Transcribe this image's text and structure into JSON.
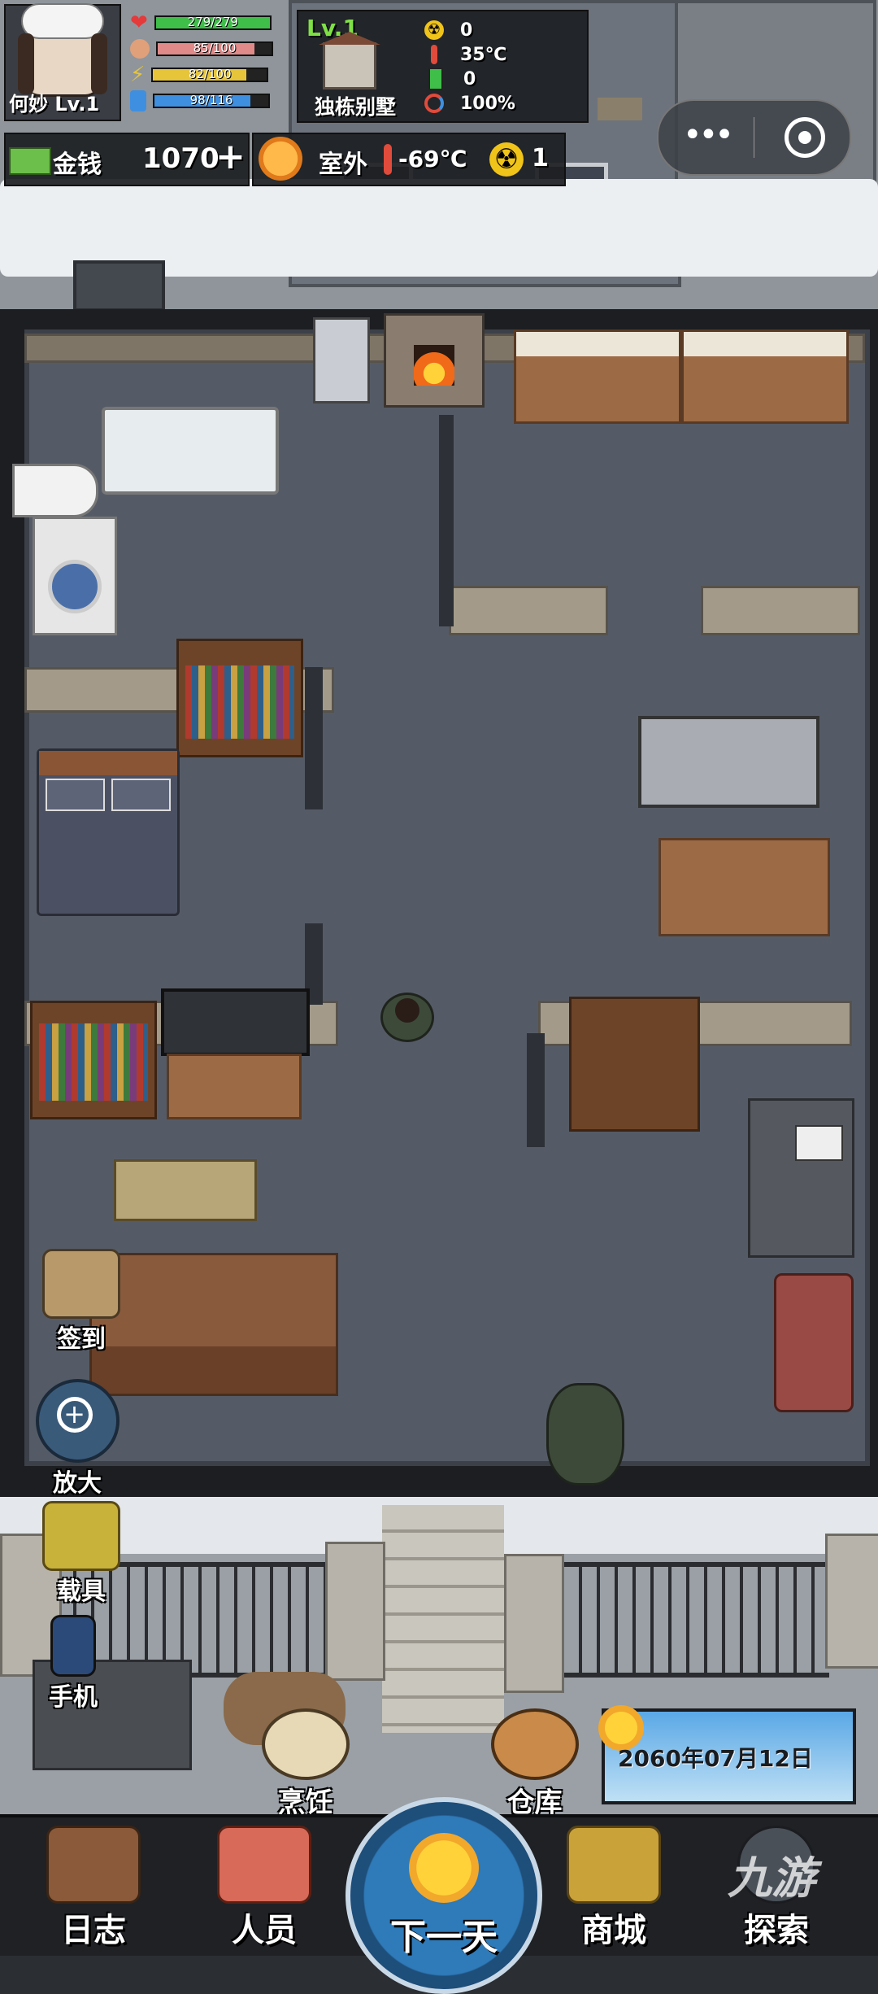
{
  "player": {
    "name_level": "何妙 Lv.1",
    "health": "279/279",
    "hunger": "85/100",
    "energy": "82/100",
    "thirst": "98/116",
    "health_pct": 1.0,
    "hunger_pct": 0.85,
    "energy_pct": 0.82,
    "thirst_pct": 0.845
  },
  "house": {
    "level": "Lv.1",
    "name": "独栋别墅",
    "radiation": "0",
    "temperature": "35℃",
    "power": "0",
    "durability": "100%"
  },
  "resources": {
    "money_label": "金钱",
    "money_value": "1070",
    "add_symbol": "+",
    "outdoor_label": "室外",
    "outdoor_temp": "-69℃",
    "outdoor_radiation": "1"
  },
  "side_buttons": {
    "checkin": "签到",
    "zoom": "放大",
    "vehicle": "载具",
    "phone": "手机"
  },
  "actions": {
    "cooking": "烹饪",
    "storage": "仓库"
  },
  "date": "2060年07月12日",
  "nav": {
    "log": "日志",
    "staff": "人员",
    "next_day": "下一天",
    "shop": "商城",
    "explore": "探索"
  },
  "watermark": "九游",
  "colors": {
    "health": "#3fbf4a",
    "hunger": "#e08a8a",
    "energy": "#e6c53a",
    "thirst": "#3f8fe0",
    "accent": "#f2a82b"
  },
  "icons": [
    "heart-icon",
    "stomach-icon",
    "lightning-icon",
    "water-icon",
    "house-icon",
    "radiation-icon",
    "thermometer-icon",
    "battery-icon",
    "durability-icon",
    "money-icon",
    "sun-icon",
    "more-icon",
    "target-icon"
  ]
}
